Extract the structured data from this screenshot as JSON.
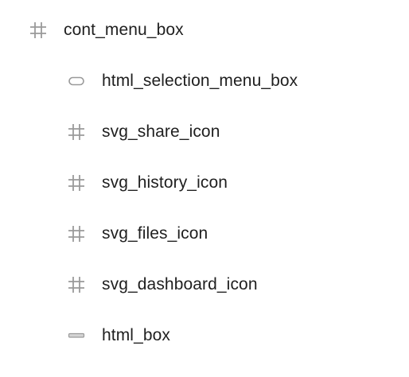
{
  "colors": {
    "text": "#1f1f1f",
    "icon": "#9a9a9a",
    "background": "#ffffff"
  },
  "layers": [
    {
      "label": "cont_menu_box",
      "icon": "frame-hash-icon"
    },
    {
      "label": "html_selection_menu_box",
      "icon": "rounded-rectangle-icon"
    },
    {
      "label": "svg_share_icon",
      "icon": "frame-hash-icon"
    },
    {
      "label": "svg_history_icon",
      "icon": "frame-hash-icon"
    },
    {
      "label": "svg_files_icon",
      "icon": "frame-hash-icon"
    },
    {
      "label": "svg_dashboard_icon",
      "icon": "frame-hash-icon"
    },
    {
      "label": "html_box",
      "icon": "flat-rectangle-icon"
    }
  ]
}
